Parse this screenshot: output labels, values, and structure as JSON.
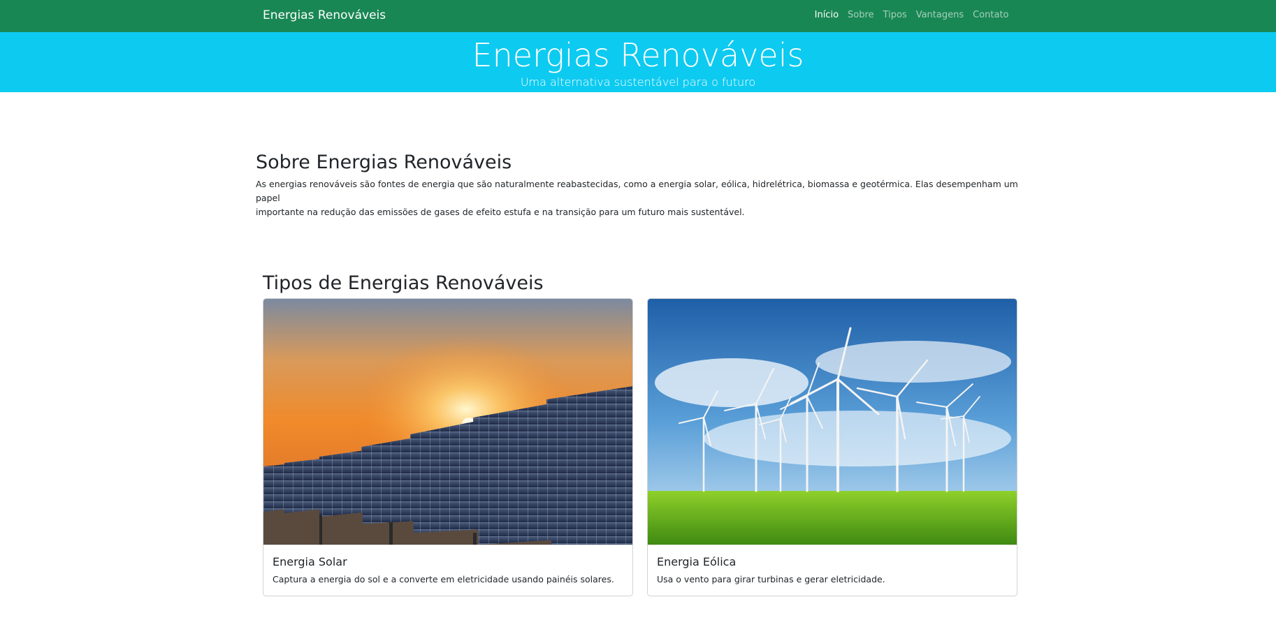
{
  "navbar": {
    "brand": "Energias Renováveis",
    "links": [
      "Início",
      "Sobre",
      "Tipos",
      "Vantagens",
      "Contato"
    ]
  },
  "hero": {
    "title": "Energias Renováveis",
    "subtitle": "Uma alternativa sustentável para o futuro"
  },
  "about": {
    "heading": "Sobre Energias Renováveis",
    "text_line1": "As energias renováveis são fontes de energia que são naturalmente reabastecidas, como a energia solar, eólica, hidrelétrica, biomassa e geotérmica. Elas desempenham um papel",
    "text_line2": "importante na redução das emissões de gases de efeito estufa e na transição para um futuro mais sustentável."
  },
  "tipos": {
    "heading": "Tipos de Energias Renováveis",
    "cards": [
      {
        "title": "Energia Solar",
        "text": "Captura a energia do sol e a converte em eletricidade usando painéis solares."
      },
      {
        "title": "Energia Eólica",
        "text": "Usa o vento para girar turbinas e gerar eletricidade."
      }
    ]
  },
  "colors": {
    "navbar": "#198754",
    "hero": "#0dcaf0"
  }
}
